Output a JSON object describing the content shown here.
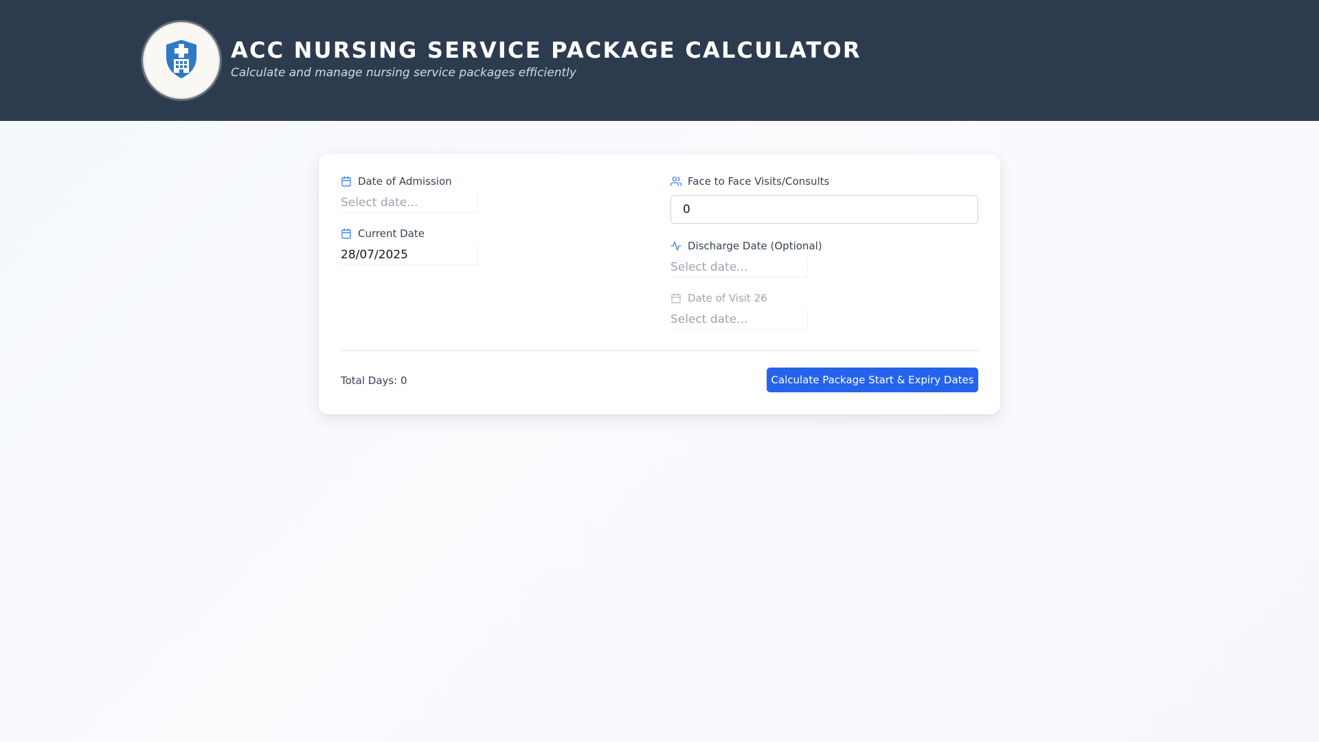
{
  "header": {
    "title": "ACC NURSING SERVICE PACKAGE CALCULATOR",
    "subtitle": "Calculate and manage nursing service packages efficiently",
    "logo_icon": "medical-shield-hospital-icon"
  },
  "form": {
    "admission": {
      "label": "Date of Admission",
      "placeholder": "Select date...",
      "value": "",
      "icon": "calendar-icon"
    },
    "current": {
      "label": "Current Date",
      "placeholder": "Select date...",
      "value": "28/07/2025",
      "icon": "calendar-icon"
    },
    "visits": {
      "label": "Face to Face Visits/Consults",
      "value": "0",
      "icon": "users-icon"
    },
    "discharge": {
      "label": "Discharge Date (Optional)",
      "placeholder": "Select date...",
      "value": "",
      "icon": "activity-icon"
    },
    "visit26": {
      "label": "Date of Visit 26",
      "placeholder": "Select date...",
      "value": "",
      "icon": "calendar-icon",
      "disabled": true
    }
  },
  "footer": {
    "total_days": "Total Days: 0",
    "calculate_label": "Calculate Package Start & Expiry Dates"
  },
  "colors": {
    "header_bg": "#2d3b4f",
    "accent": "#2563eb",
    "icon_blue": "#3b82f6",
    "logo_shield": "#2f7ac4"
  }
}
